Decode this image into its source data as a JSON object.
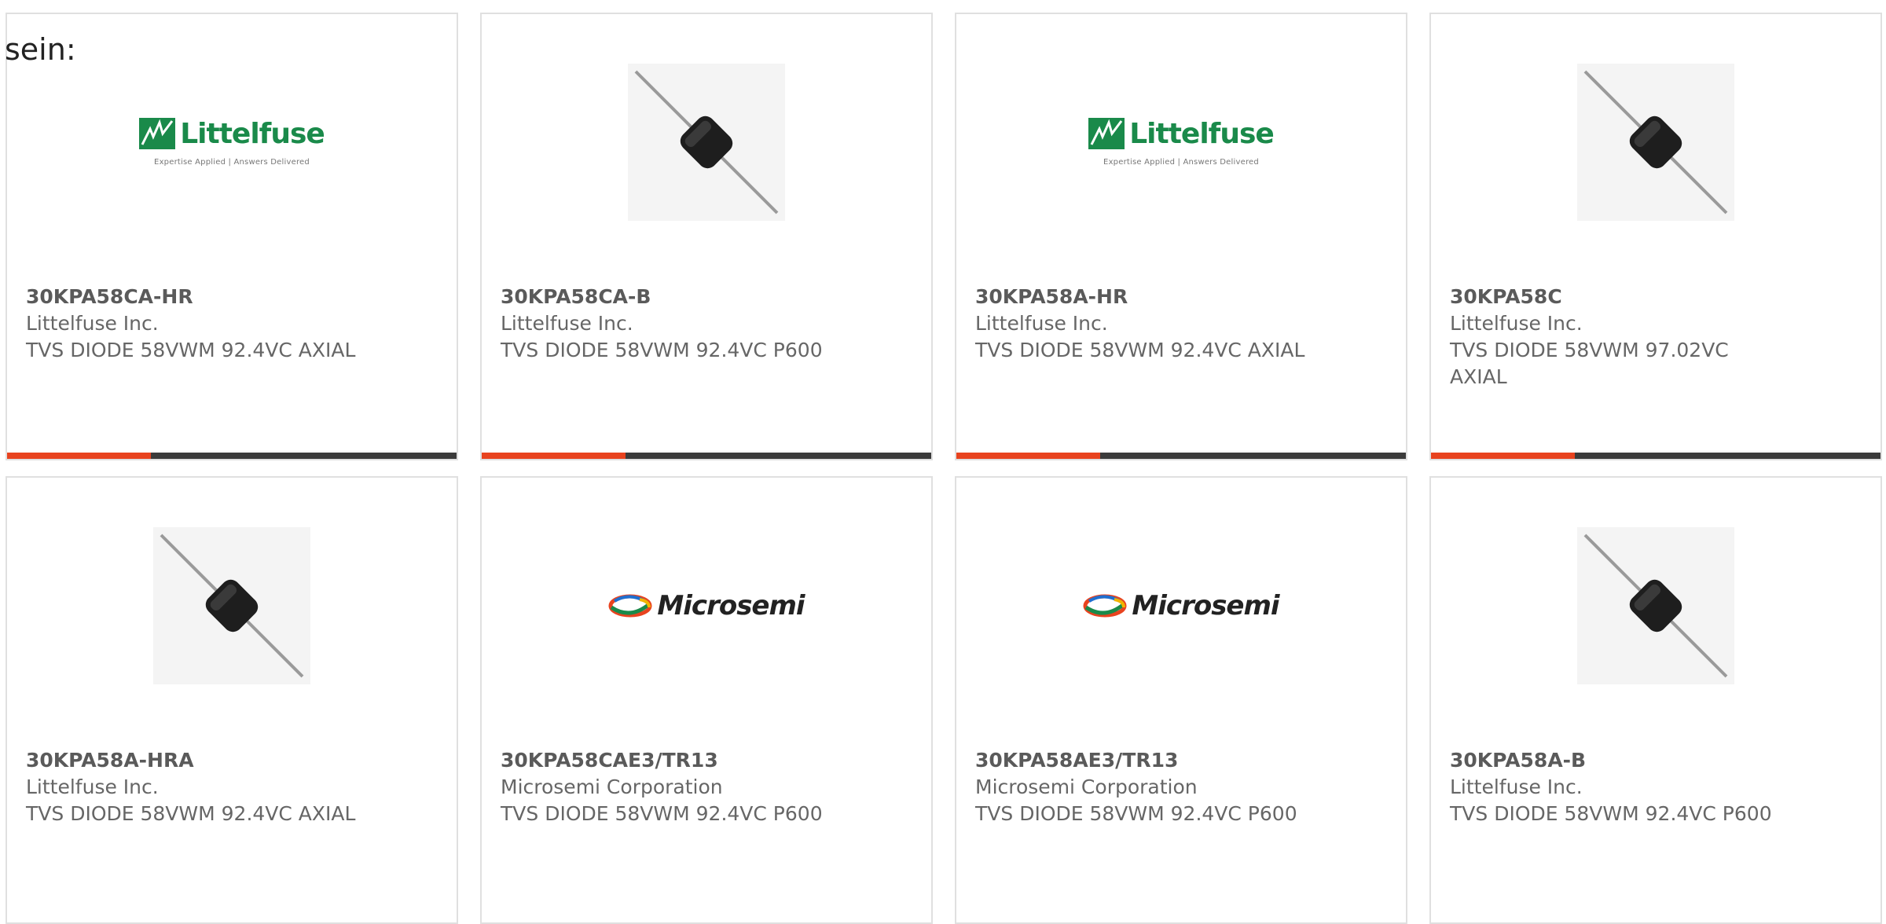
{
  "intro_text": "sein:",
  "brand_colors": {
    "accent": "#e8431f",
    "bar": "#3b3b3b",
    "littelfuse_green": "#1a8a4a"
  },
  "cards": [
    {
      "part_number": "30KPA58CA-HR",
      "manufacturer": "Littelfuse Inc.",
      "description": "TVS DIODE 58VWM 92.4VC AXIAL",
      "image": "littelfuse-logo"
    },
    {
      "part_number": "30KPA58CA-B",
      "manufacturer": "Littelfuse Inc.",
      "description": "TVS DIODE 58VWM 92.4VC P600",
      "image": "diode-photo"
    },
    {
      "part_number": "30KPA58A-HR",
      "manufacturer": "Littelfuse Inc.",
      "description": "TVS DIODE 58VWM 92.4VC AXIAL",
      "image": "littelfuse-logo"
    },
    {
      "part_number": "30KPA58C",
      "manufacturer": "Littelfuse Inc.",
      "description": "TVS DIODE 58VWM 97.02VC AXIAL",
      "image": "diode-photo"
    },
    {
      "part_number": "30KPA58A-HRA",
      "manufacturer": "Littelfuse Inc.",
      "description": "TVS DIODE 58VWM 92.4VC AXIAL",
      "image": "diode-photo"
    },
    {
      "part_number": "30KPA58CAE3/TR13",
      "manufacturer": "Microsemi Corporation",
      "description": "TVS DIODE 58VWM 92.4VC P600",
      "image": "microsemi-logo"
    },
    {
      "part_number": "30KPA58AE3/TR13",
      "manufacturer": "Microsemi Corporation",
      "description": "TVS DIODE 58VWM 92.4VC P600",
      "image": "microsemi-logo"
    },
    {
      "part_number": "30KPA58A-B",
      "manufacturer": "Littelfuse Inc.",
      "description": "TVS DIODE 58VWM 92.4VC P600",
      "image": "diode-photo"
    }
  ],
  "logos": {
    "littelfuse": {
      "name": "Littelfuse",
      "tagline": "Expertise Applied | Answers Delivered"
    },
    "microsemi": {
      "name": "Microsemi"
    }
  }
}
